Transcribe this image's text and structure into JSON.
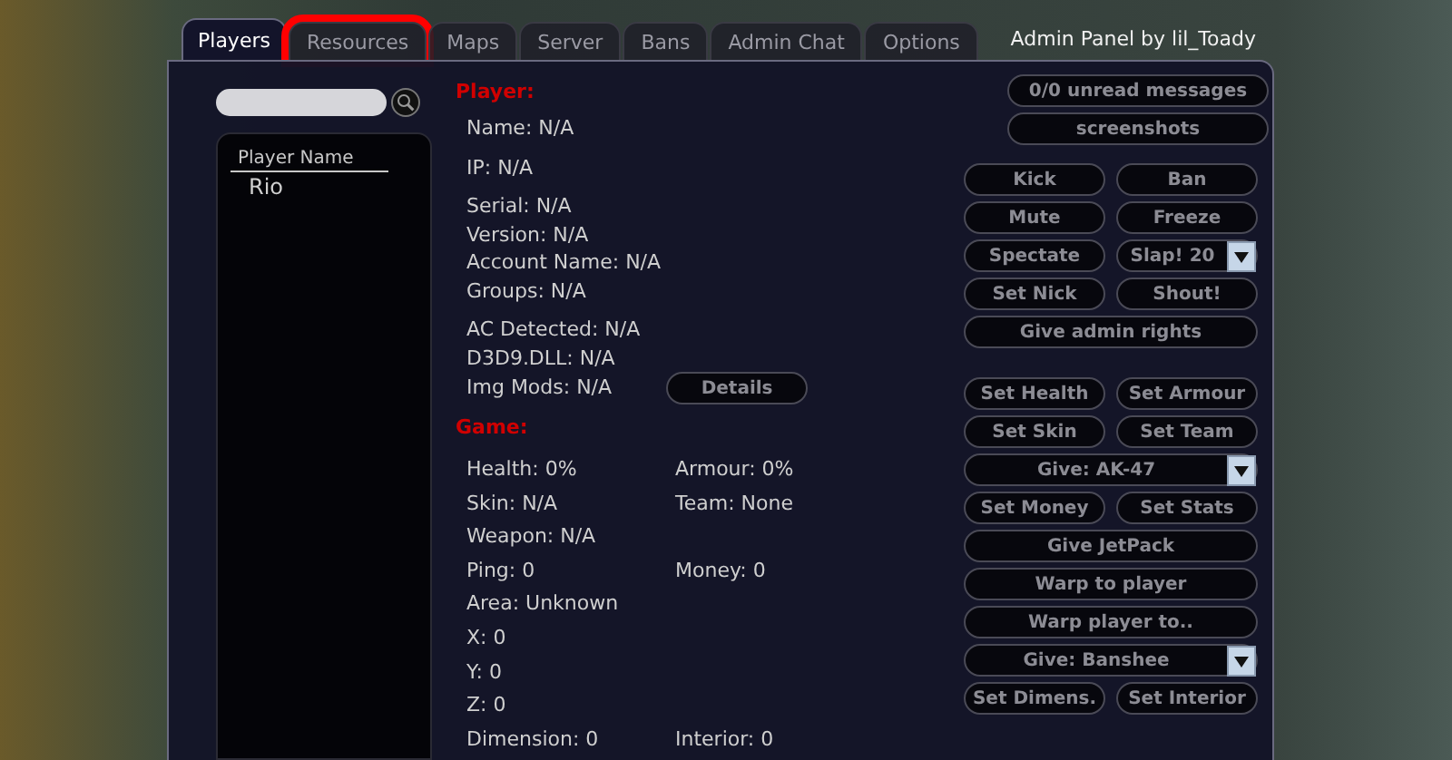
{
  "window": {
    "title": "Admin Panel by lil_Toady"
  },
  "tabs": [
    {
      "label": "Players",
      "selected": true,
      "highlighted": false
    },
    {
      "label": "Resources",
      "selected": false,
      "highlighted": true
    },
    {
      "label": "Maps",
      "selected": false,
      "highlighted": false
    },
    {
      "label": "Server",
      "selected": false,
      "highlighted": false
    },
    {
      "label": "Bans",
      "selected": false,
      "highlighted": false
    },
    {
      "label": "Admin Chat",
      "selected": false,
      "highlighted": false
    },
    {
      "label": "Options",
      "selected": false,
      "highlighted": false
    }
  ],
  "player_list": {
    "column": "Player Name",
    "rows": [
      {
        "name": "Rio",
        "selected": false
      }
    ]
  },
  "player_section": {
    "heading": "Player:",
    "groups": [
      [
        "Name: N/A"
      ],
      [
        "IP: N/A"
      ],
      [
        "Serial: N/A",
        "Version: N/A",
        "Account Name: N/A",
        "Groups: N/A"
      ],
      [
        "AC Detected: N/A",
        "D3D9.DLL: N/A",
        "Img Mods: N/A"
      ]
    ],
    "details_button": "Details"
  },
  "game_section": {
    "heading": "Game:",
    "rows": [
      [
        "Health: 0%",
        "Armour: 0%"
      ],
      [
        "Skin: N/A",
        "Team: None"
      ],
      [
        "Weapon: N/A"
      ],
      [
        "Ping: 0",
        "Money: 0"
      ],
      [
        "Area: Unknown"
      ],
      [
        "X: 0"
      ],
      [
        "Y: 0"
      ],
      [
        "Z: 0"
      ],
      [
        "Dimension: 0",
        "Interior: 0"
      ]
    ]
  },
  "action_groups": [
    [
      {
        "label": "0/0 unread messages",
        "kind": "button",
        "wide": true
      },
      {
        "label": "screenshots",
        "kind": "button",
        "wide": true
      }
    ],
    [
      {
        "label": "Kick",
        "kind": "button",
        "wide": false
      },
      {
        "label": "Ban",
        "kind": "button",
        "wide": false
      },
      {
        "label": "Mute",
        "kind": "button",
        "wide": false
      },
      {
        "label": "Freeze",
        "kind": "button",
        "wide": false
      },
      {
        "label": "Spectate",
        "kind": "button",
        "wide": false
      },
      {
        "label": "Slap! 20",
        "kind": "dropdown",
        "wide": false
      },
      {
        "label": "Set Nick",
        "kind": "button",
        "wide": false
      },
      {
        "label": "Shout!",
        "kind": "button",
        "wide": false
      },
      {
        "label": "Give admin rights",
        "kind": "button",
        "wide": true
      }
    ],
    [
      {
        "label": "Set Health",
        "kind": "button",
        "wide": false
      },
      {
        "label": "Set Armour",
        "kind": "button",
        "wide": false
      },
      {
        "label": "Set Skin",
        "kind": "button",
        "wide": false
      },
      {
        "label": "Set Team",
        "kind": "button",
        "wide": false
      },
      {
        "label": "Give: AK-47",
        "kind": "dropdown",
        "wide": true
      },
      {
        "label": "Set Money",
        "kind": "button",
        "wide": false
      },
      {
        "label": "Set Stats",
        "kind": "button",
        "wide": false
      },
      {
        "label": "Give JetPack",
        "kind": "button",
        "wide": true
      },
      {
        "label": "Warp to player",
        "kind": "button",
        "wide": true
      },
      {
        "label": "Warp player to..",
        "kind": "button",
        "wide": true
      },
      {
        "label": "Give: Banshee",
        "kind": "dropdown",
        "wide": true
      },
      {
        "label": "Set Dimens.",
        "kind": "button",
        "wide": false
      },
      {
        "label": "Set Interior",
        "kind": "button",
        "wide": false
      }
    ]
  ]
}
